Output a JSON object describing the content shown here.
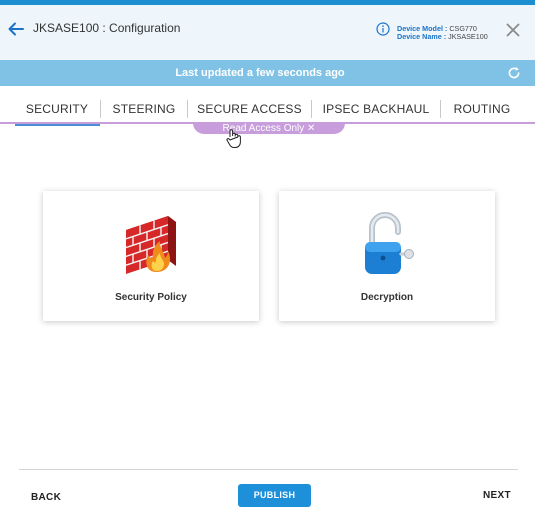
{
  "header": {
    "title": "JKSASE100 : Configuration",
    "device_model_label": "Device Model",
    "device_model_value": "CSG770",
    "device_name_label": "Device Name",
    "device_name_value": "JKSASE100",
    "icons": {
      "back": "back-arrow-icon",
      "info": "info-icon",
      "close": "close-icon"
    }
  },
  "status": {
    "text": "Last updated a few seconds ago",
    "icon": "refresh-icon"
  },
  "tabs": [
    {
      "label": "SECURITY",
      "active": true
    },
    {
      "label": "STEERING",
      "active": false
    },
    {
      "label": "SECURE ACCESS",
      "active": false
    },
    {
      "label": "IPSEC BACKHAUL",
      "active": false
    },
    {
      "label": "ROUTING",
      "active": false
    }
  ],
  "ribbon": {
    "text": "Read Access Only",
    "icon": "pin-icon"
  },
  "cards": [
    {
      "label": "Security Policy",
      "icon": "firewall-icon"
    },
    {
      "label": "Decryption",
      "icon": "padlock-icon"
    }
  ],
  "footer": {
    "back_label": "BACK",
    "publish_label": "PUBLISH",
    "next_label": "NEXT"
  },
  "colors": {
    "top_strip": "#1d8fd0",
    "header_bg": "#eef6fb",
    "status_bar": "#80c2e6",
    "ribbon": "#c79ddc",
    "active_tab": "#4a8fd4",
    "publish_button": "#1e8fd9"
  }
}
